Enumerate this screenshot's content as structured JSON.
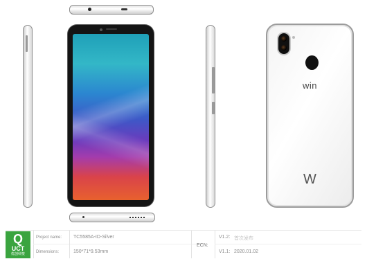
{
  "views": {
    "back_brand": "win",
    "back_logo": "W"
  },
  "title_block": {
    "logo_mark": "Q",
    "logo_name": "UCT",
    "logo_subtitle": "优创科技",
    "project_name_label": "Project name:",
    "project_name_value": "TC5585A-ID-Silver",
    "dimensions_label": "Dimensions:",
    "dimensions_value": "150*71*9.53mm",
    "ecn_label": "ECN:",
    "version_1_label": "V1.2:",
    "version_1_value": "首次发布",
    "version_2_label": "V1.1:",
    "version_2_value": "2020.01.02"
  },
  "colors": {
    "logo_green": "#3aa43f",
    "screen_gradient": [
      "#1fa0b8",
      "#2b86d0",
      "#6a3bbd",
      "#d9434a",
      "#e8612e"
    ],
    "body_silver": "#f4f4f4"
  }
}
